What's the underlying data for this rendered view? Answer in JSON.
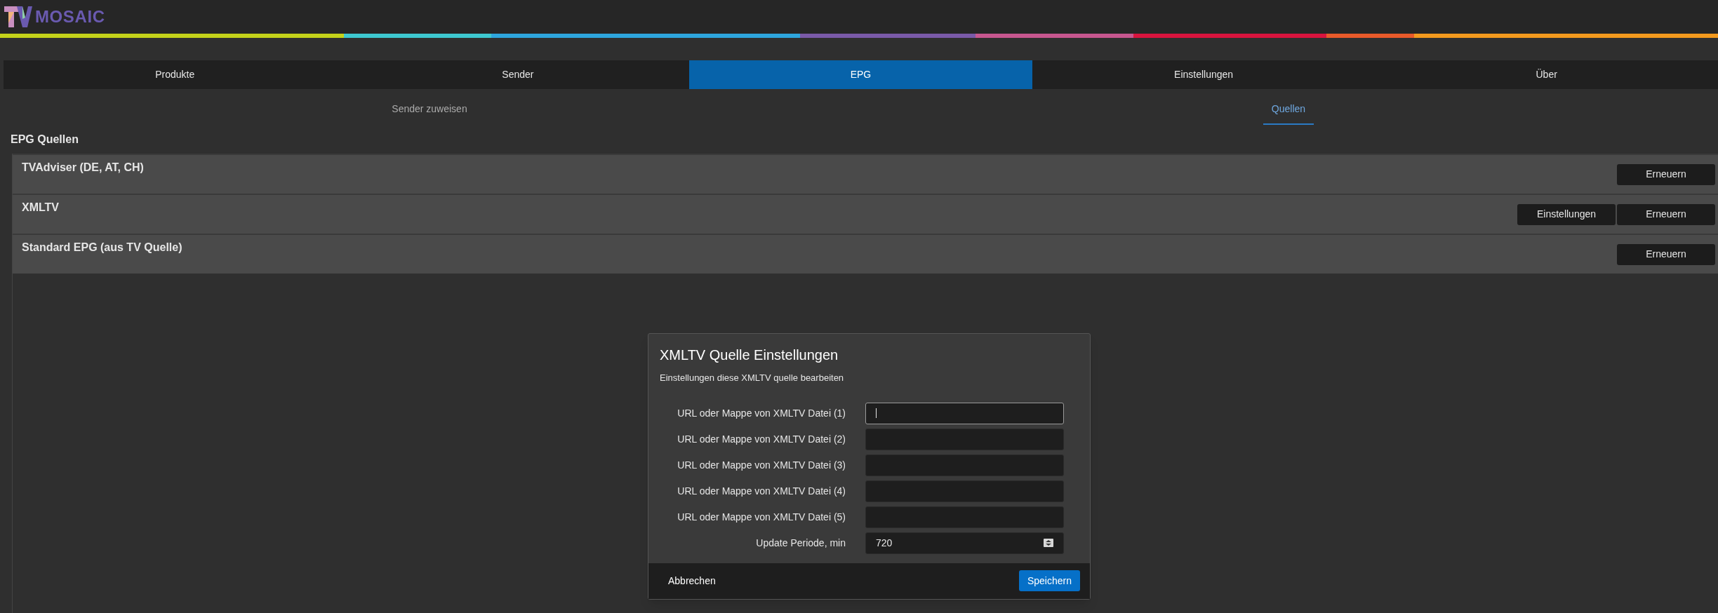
{
  "logo": {
    "text": "MOSAIC"
  },
  "tabs": [
    {
      "label": "Produkte",
      "selected": false
    },
    {
      "label": "Sender",
      "selected": false
    },
    {
      "label": "EPG",
      "selected": true
    },
    {
      "label": "Einstellungen",
      "selected": false
    },
    {
      "label": "Über",
      "selected": false
    }
  ],
  "subtabs": [
    {
      "label": "Sender zuweisen",
      "selected": false
    },
    {
      "label": "Quellen",
      "selected": true
    }
  ],
  "section_title": "EPG Quellen",
  "sources": [
    {
      "name": "TVAdviser (DE, AT, CH)",
      "buttons": [
        "Erneuern"
      ]
    },
    {
      "name": "XMLTV",
      "buttons": [
        "Einstellungen",
        "Erneuern"
      ]
    },
    {
      "name": "Standard EPG (aus TV Quelle)",
      "buttons": [
        "Erneuern"
      ]
    }
  ],
  "dialog": {
    "title": "XMLTV Quelle Einstellungen",
    "subtitle": "Einstellungen diese XMLTV quelle bearbeiten",
    "fields": [
      {
        "kind": "text",
        "label": "URL oder Mappe von XMLTV Datei (1)",
        "focused": true
      },
      {
        "kind": "text",
        "label": "URL oder Mappe von XMLTV Datei (2)",
        "focused": false
      },
      {
        "kind": "text",
        "label": "URL oder Mappe von XMLTV Datei (3)",
        "focused": false
      },
      {
        "kind": "text",
        "label": "URL oder Mappe von XMLTV Datei (4)",
        "focused": false
      },
      {
        "kind": "text",
        "label": "URL oder Mappe von XMLTV Datei (5)",
        "focused": false
      },
      {
        "kind": "number",
        "label": "Update Periode, min",
        "value": "720",
        "focused": false
      }
    ],
    "cancel": "Abbrechen",
    "save": "Speichern"
  }
}
